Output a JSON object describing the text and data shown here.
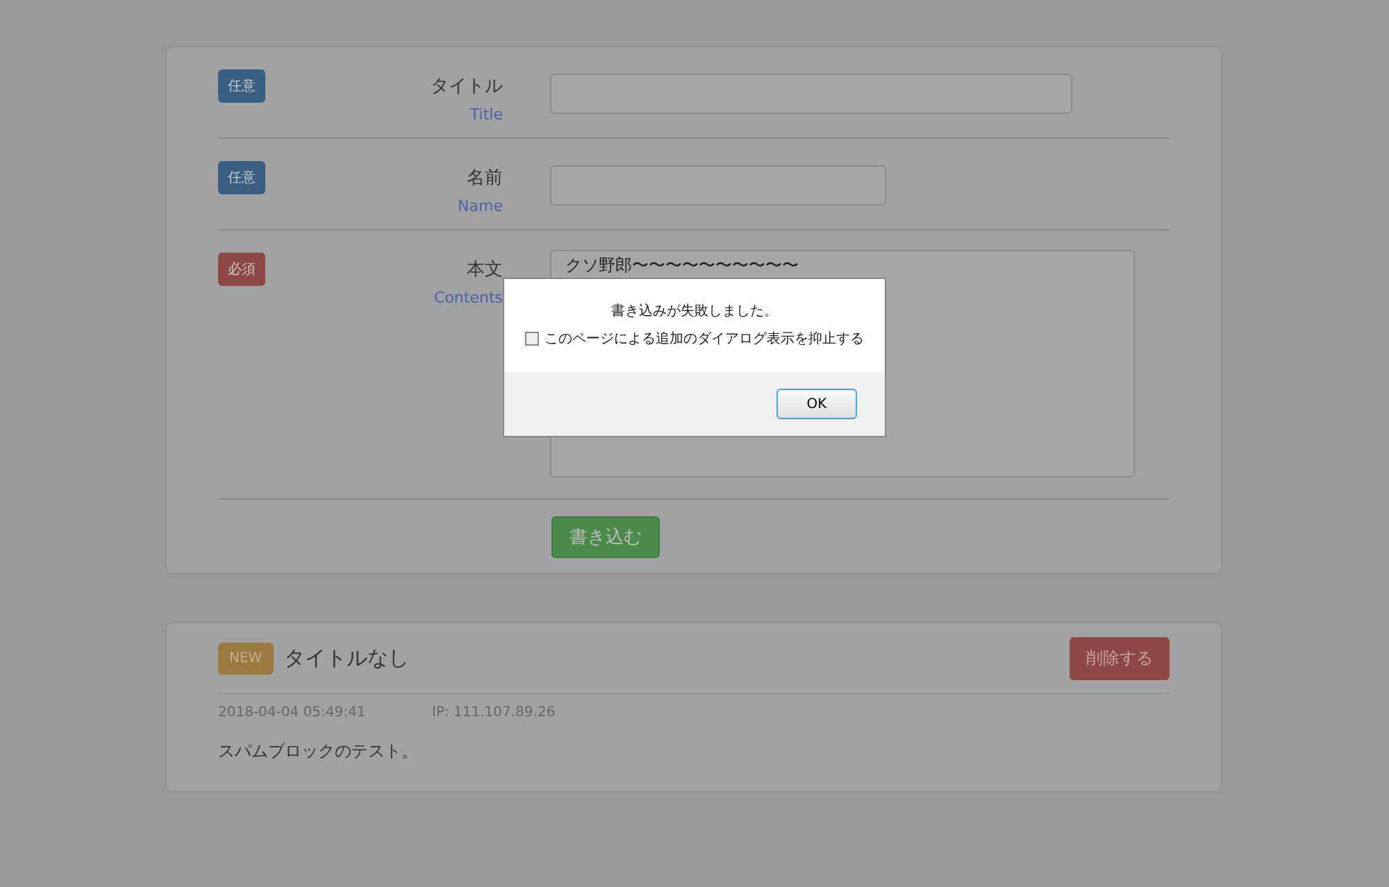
{
  "form": {
    "fields": [
      {
        "badge": "任意",
        "required": false,
        "label": "タイトル",
        "sublabel": "Title",
        "kind": "wide"
      },
      {
        "badge": "任意",
        "required": false,
        "label": "名前",
        "sublabel": "Name",
        "kind": "narrow"
      },
      {
        "badge": "必須",
        "required": true,
        "label": "本文",
        "sublabel": "Contents",
        "kind": "textarea",
        "value": "クソ野郎〜〜〜〜〜〜〜〜〜〜"
      }
    ],
    "submit": "書き込む"
  },
  "post": {
    "badge": "NEW",
    "title": "タイトルなし",
    "delete_button": "削除する",
    "date": "2018-04-04 05:49:41",
    "ip": "IP: 111.107.89.26",
    "body": "スパムブロックのテスト。"
  },
  "dialog": {
    "message": "書き込みが失敗しました。",
    "checkbox": {
      "label": "このページによる追加のダイアログ表示を抑止する",
      "checked": false
    },
    "button": "OK"
  }
}
